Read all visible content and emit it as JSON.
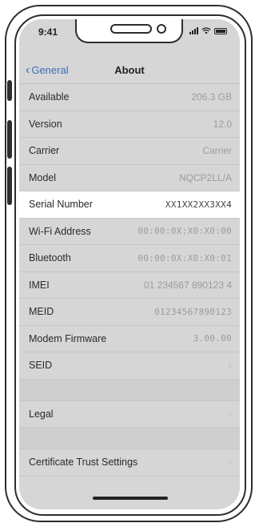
{
  "status": {
    "time": "9:41"
  },
  "nav": {
    "back_label": "General",
    "title": "About"
  },
  "rows": [
    {
      "label": "Available",
      "value": "206.3 GB"
    },
    {
      "label": "Version",
      "value": "12.0"
    },
    {
      "label": "Carrier",
      "value": "Carrier"
    },
    {
      "label": "Model",
      "value": "NQCP2LL/A"
    },
    {
      "label": "Serial Number",
      "value": "XX1XX2XX3XX4"
    },
    {
      "label": "Wi-Fi Address",
      "value": "00:00:0X:X0:X0:00"
    },
    {
      "label": "Bluetooth",
      "value": "00:00:0X:X0:X0:01"
    },
    {
      "label": "IMEI",
      "value": "01 234567 890123 4"
    },
    {
      "label": "MEID",
      "value": "01234567890123"
    },
    {
      "label": "Modem Firmware",
      "value": "3.00.00"
    },
    {
      "label": "SEID",
      "value": ""
    }
  ],
  "legal": {
    "label": "Legal"
  },
  "cert": {
    "label": "Certificate Trust Settings"
  },
  "icons": {
    "back": "chevron-left-icon",
    "disclosure": "chevron-right-icon"
  }
}
